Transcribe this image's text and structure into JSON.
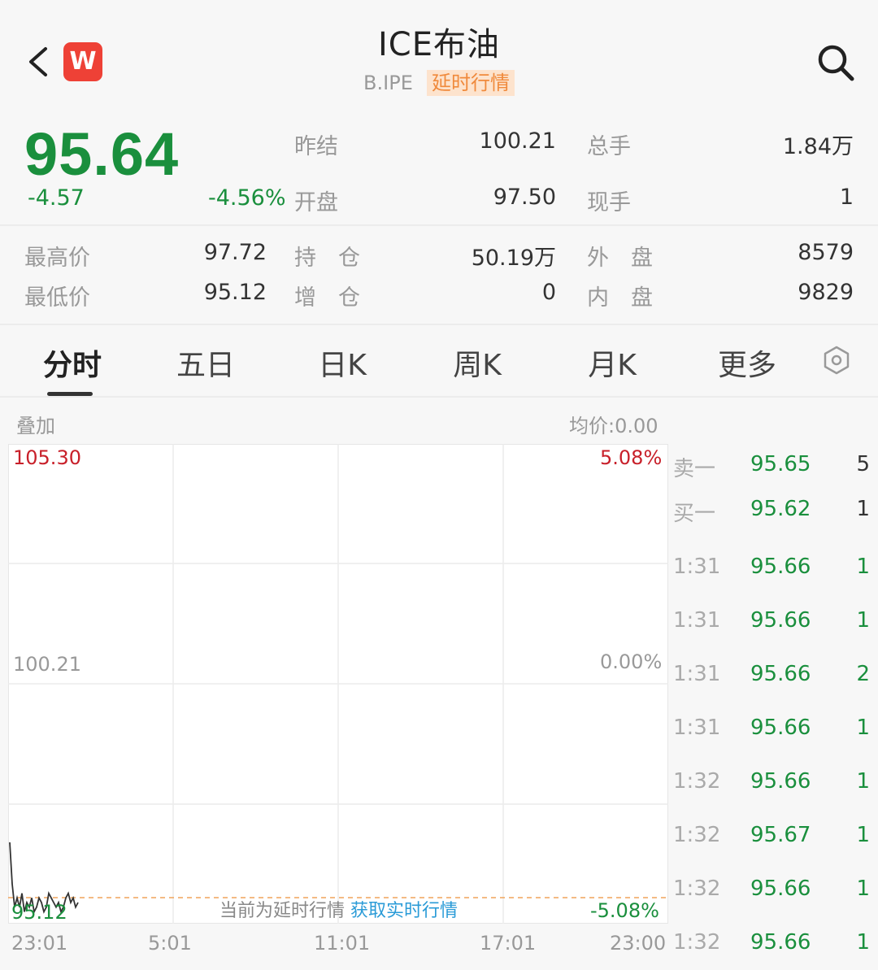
{
  "header": {
    "title": "ICE布油",
    "code": "B.IPE",
    "delay_tag": "延时行情",
    "app_logo": "W"
  },
  "quote": {
    "price": "95.64",
    "change": "-4.57",
    "change_pct": "-4.56%",
    "colors": {
      "down": "#1a8f3d",
      "up": "#c8202a"
    },
    "stats": [
      {
        "label": "昨结",
        "value": "100.21"
      },
      {
        "label": "总手",
        "value": "1.84万"
      },
      {
        "label": "开盘",
        "value": "97.50"
      },
      {
        "label": "现手",
        "value": "1"
      },
      {
        "label": "最高价",
        "value": "97.72"
      },
      {
        "label": "持　仓",
        "value": "50.19万"
      },
      {
        "label": "外　盘",
        "value": "8579"
      },
      {
        "label": "最低价",
        "value": "95.12"
      },
      {
        "label": "增　仓",
        "value": "0"
      },
      {
        "label": "内　盘",
        "value": "9829"
      }
    ]
  },
  "tabs": [
    "分时",
    "五日",
    "日K",
    "周K",
    "月K",
    "更多"
  ],
  "active_tab": 0,
  "chart": {
    "overlay_label": "叠加",
    "avg_price": "均价:0.00",
    "y_top": "105.30",
    "y_mid": "100.21",
    "y_bottom": "95.12",
    "pct_top": "5.08%",
    "pct_mid": "0.00%",
    "pct_bottom": "-5.08%",
    "x_ticks": [
      "23:01",
      "5:01",
      "11:01",
      "17:01",
      "23:00"
    ],
    "notice_text": "当前为延时行情",
    "notice_link": "获取实时行情"
  },
  "chart_data": {
    "type": "line",
    "ylim": [
      95.12,
      105.3
    ],
    "series": [
      {
        "values": [
          96.7,
          95.8,
          95.3,
          95.5,
          95.3,
          95.6,
          95.2,
          95.4,
          95.3,
          95.5,
          95.2,
          95.3,
          95.5,
          95.4,
          95.2,
          95.3,
          95.6,
          95.5,
          95.4,
          95.3,
          95.4,
          95.2,
          95.3,
          95.5,
          95.6,
          95.4,
          95.5,
          95.3,
          95.4
        ]
      }
    ]
  },
  "order_book": [
    {
      "label": "卖一",
      "price": "95.65",
      "vol": "5"
    },
    {
      "label": "买一",
      "price": "95.62",
      "vol": "1"
    }
  ],
  "ticks": [
    {
      "time": "1:31",
      "price": "95.66",
      "vol": "1"
    },
    {
      "time": "1:31",
      "price": "95.66",
      "vol": "1"
    },
    {
      "time": "1:31",
      "price": "95.66",
      "vol": "2"
    },
    {
      "time": "1:31",
      "price": "95.66",
      "vol": "1"
    },
    {
      "time": "1:32",
      "price": "95.66",
      "vol": "1"
    },
    {
      "time": "1:32",
      "price": "95.67",
      "vol": "1"
    },
    {
      "time": "1:32",
      "price": "95.66",
      "vol": "1"
    },
    {
      "time": "1:32",
      "price": "95.66",
      "vol": "1"
    }
  ]
}
